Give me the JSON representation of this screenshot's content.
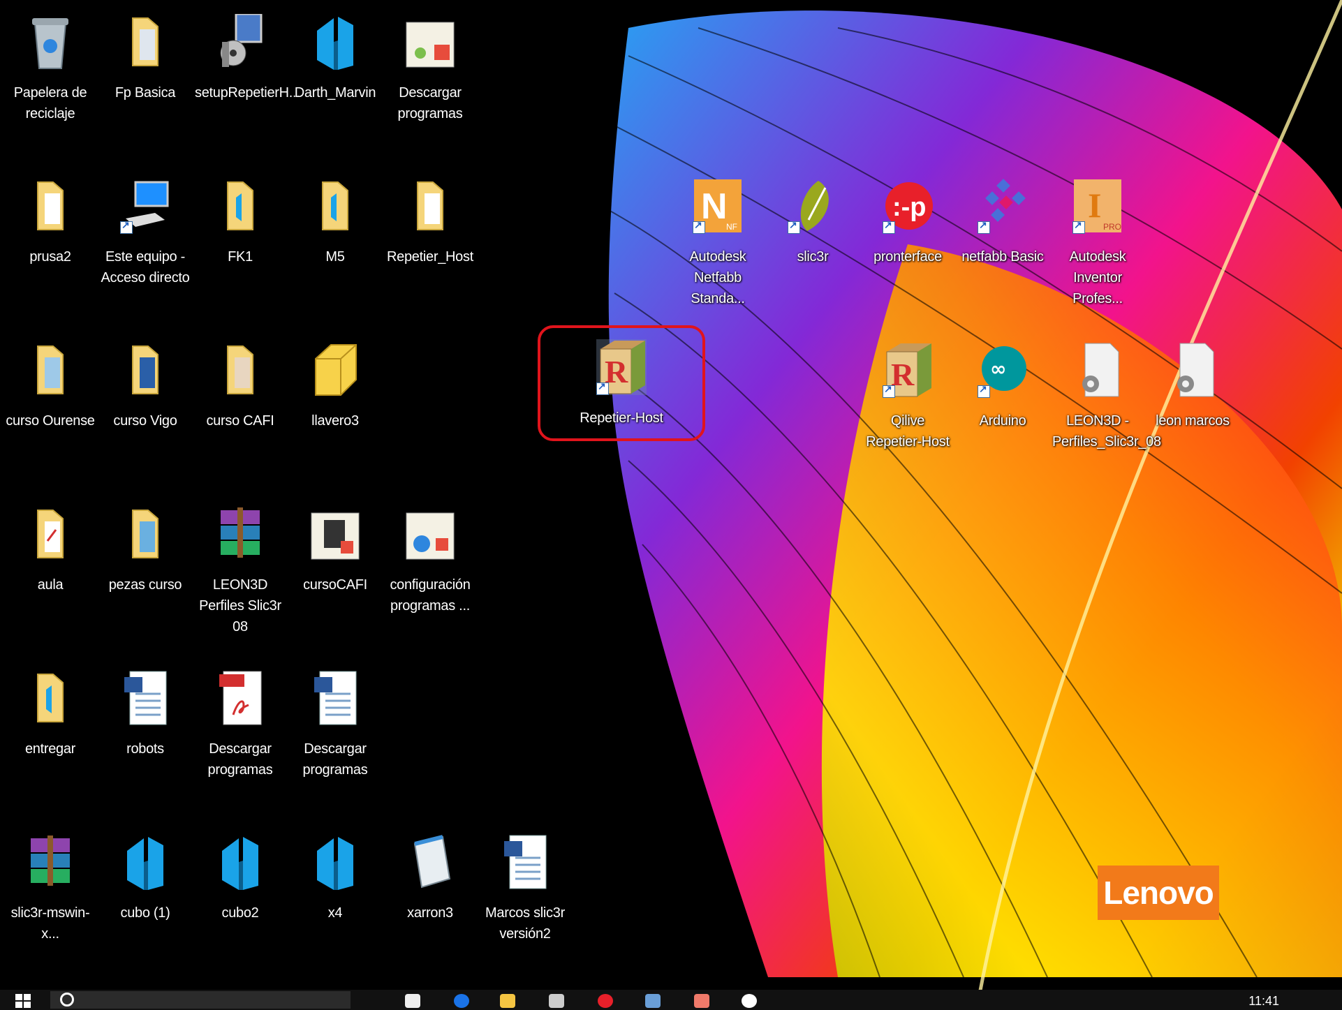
{
  "desktop": {
    "icons_left": [
      {
        "label": "Papelera de reciclaje",
        "icon": "recycle-bin-icon"
      },
      {
        "label": "Fp Basica",
        "icon": "folder-icon"
      },
      {
        "label": "setupRepetierH...",
        "icon": "installer-icon"
      },
      {
        "label": "Darth_Marvin",
        "icon": "3d-model-icon"
      },
      {
        "label": "Descargar programas",
        "icon": "image-file-icon"
      },
      {
        "label": "prusa2",
        "icon": "folder-icon"
      },
      {
        "label": "Este equipo - Acceso directo",
        "icon": "computer-icon"
      },
      {
        "label": "FK1",
        "icon": "folder-icon"
      },
      {
        "label": "M5",
        "icon": "folder-icon"
      },
      {
        "label": "Repetier_Host",
        "icon": "folder-icon"
      },
      {
        "label": "curso Ourense",
        "icon": "folder-icon"
      },
      {
        "label": "curso Vigo",
        "icon": "folder-icon"
      },
      {
        "label": "curso CAFI",
        "icon": "folder-icon"
      },
      {
        "label": "llavero3",
        "icon": "cube-file-icon"
      },
      {
        "label": "aula",
        "icon": "folder-icon"
      },
      {
        "label": "pezas curso",
        "icon": "folder-icon"
      },
      {
        "label": "LEON3D Perfiles Slic3r 08",
        "icon": "winrar-icon"
      },
      {
        "label": "cursoCAFI",
        "icon": "image-file-icon"
      },
      {
        "label": "configuración programas ...",
        "icon": "image-file-icon"
      },
      {
        "label": "entregar",
        "icon": "folder-icon"
      },
      {
        "label": "robots",
        "icon": "word-doc-icon"
      },
      {
        "label": "Descargar programas",
        "icon": "pdf-icon"
      },
      {
        "label": "Descargar programas",
        "icon": "word-doc-icon"
      },
      {
        "label": "slic3r-mswin-x...",
        "icon": "winrar-icon"
      },
      {
        "label": "cubo (1)",
        "icon": "3d-model-icon"
      },
      {
        "label": "cubo2",
        "icon": "3d-model-icon"
      },
      {
        "label": "x4",
        "icon": "3d-model-icon"
      },
      {
        "label": "xarron3",
        "icon": "notepad-icon"
      },
      {
        "label": "Marcos slic3r versión2",
        "icon": "word-doc-icon"
      }
    ],
    "icons_right": [
      {
        "label": "Autodesk Netfabb Standa...",
        "icon": "netfabb-icon"
      },
      {
        "label": "slic3r",
        "icon": "slic3r-icon"
      },
      {
        "label": "pronterface",
        "icon": "pronterface-icon"
      },
      {
        "label": "netfabb Basic",
        "icon": "netfabb-basic-icon"
      },
      {
        "label": "Autodesk Inventor Profes...",
        "icon": "inventor-icon"
      },
      {
        "label": "Repetier-Host",
        "icon": "repetier-icon"
      },
      {
        "label": "Qilive Repetier-Host",
        "icon": "repetier-icon"
      },
      {
        "label": "Arduino",
        "icon": "arduino-icon"
      },
      {
        "label": "LEON3D - Perfiles_Slic3r_08",
        "icon": "settings-file-icon"
      },
      {
        "label": "leon marcos",
        "icon": "settings-file-icon"
      }
    ],
    "brand": "Lenovo",
    "highlight_color": "#e0141c"
  },
  "taskbar": {
    "clock": "11:41"
  }
}
